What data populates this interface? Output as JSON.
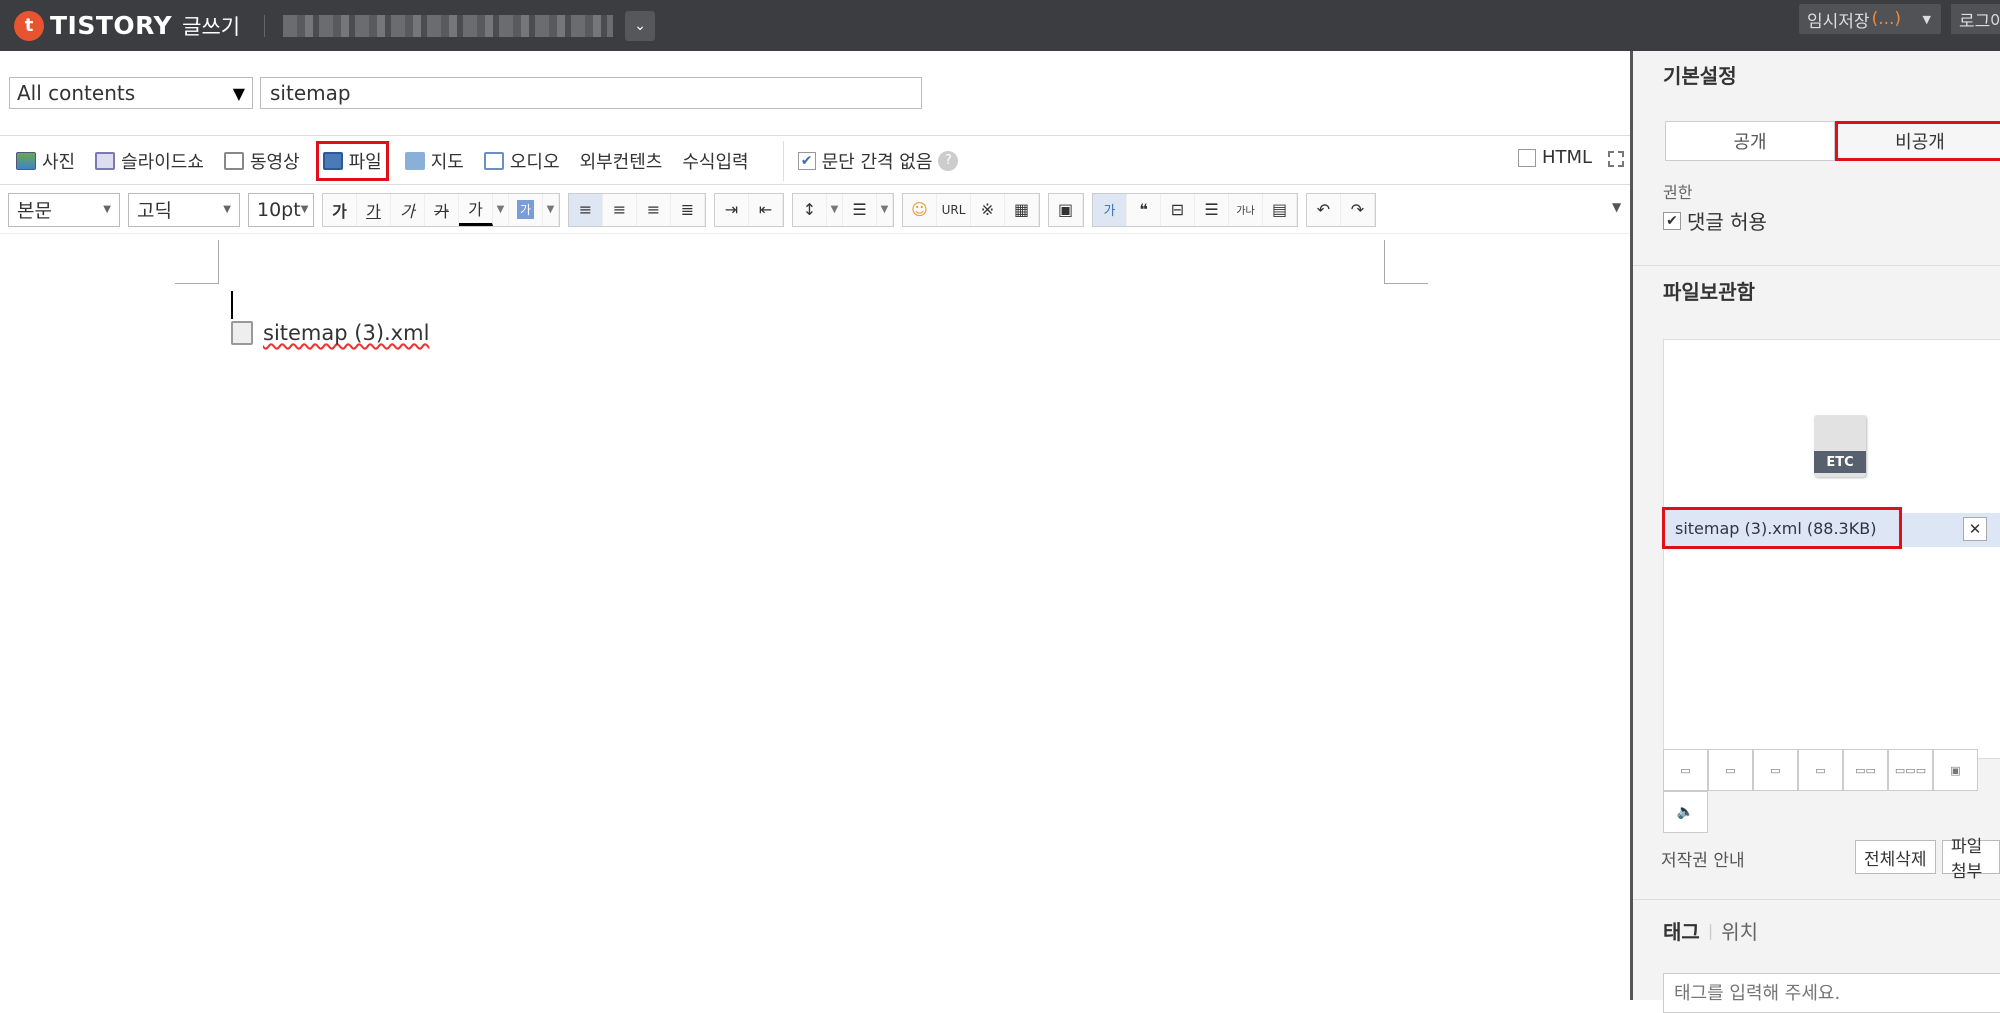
{
  "topbar": {
    "logo_text": "TISTORY",
    "logo_sub": "글쓰기",
    "temp_save_label": "임시저장",
    "temp_save_count": "(...)",
    "login_label": "로그아"
  },
  "editor": {
    "category": "All contents",
    "title_value": "sitemap",
    "toolbar1": {
      "photo": "사진",
      "slideshow": "슬라이드쇼",
      "video": "동영상",
      "file": "파일",
      "map": "지도",
      "audio": "오디오",
      "external": "외부컨텐츠",
      "formula": "수식입력",
      "no_paragraph_gap": "문단 간격 없음",
      "html": "HTML"
    },
    "toolbar2": {
      "style": "본문",
      "font": "고딕",
      "size": "10pt"
    },
    "attached_file": "sitemap (3).xml"
  },
  "sidebar": {
    "basic_settings": "기본설정",
    "public": "공개",
    "private": "비공개",
    "permission": "권한",
    "allow_comments": "댓글 허용",
    "file_vault": "파일보관함",
    "etc_badge": "ETC",
    "file_entry": "sitemap (3).xml (88.3KB)",
    "copyright": "저작권 안내",
    "delete_all": "전체삭제",
    "attach_file": "파일첨부",
    "tag_tab": "태그",
    "location_tab": "위치",
    "tag_placeholder": "태그를 입력해 주세요."
  },
  "colors": {
    "topbar_bg": "#3b3d41",
    "logo_accent": "#e8542f",
    "highlight": "#e0101a"
  }
}
